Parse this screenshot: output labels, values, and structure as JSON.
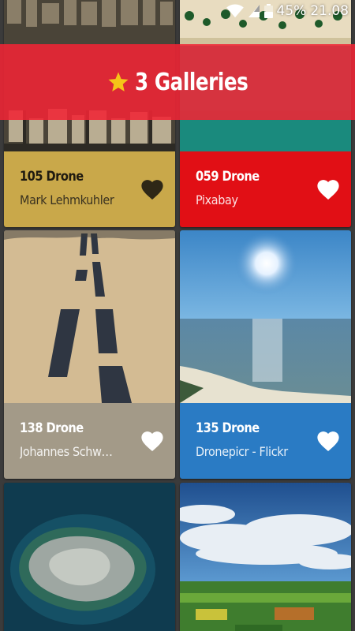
{
  "status_bar": {
    "battery_percent": "45%",
    "time": "21.08"
  },
  "banner": {
    "label": "3 Galleries",
    "icon": "star-icon",
    "star_color": "#f5c518",
    "background": "#f02434"
  },
  "galleries": [
    {
      "title": "105 Drone",
      "author": "Mark Lehmkuhler",
      "favorited": true,
      "info_color": "#c9a84a",
      "heart_color": "#2e2716"
    },
    {
      "title": "059 Drone",
      "author": "Pixabay",
      "favorited": false,
      "info_color": "#e10f15",
      "heart_color": "#ffffff"
    },
    {
      "title": "138 Drone",
      "author": "Johannes Schwaerzler",
      "favorited": false,
      "info_color": "#a39a88",
      "heart_color": "#ffffff"
    },
    {
      "title": "135 Drone",
      "author": "Dronepicr - Flickr",
      "favorited": false,
      "info_color": "#2a7bc4",
      "heart_color": "#ffffff"
    }
  ]
}
